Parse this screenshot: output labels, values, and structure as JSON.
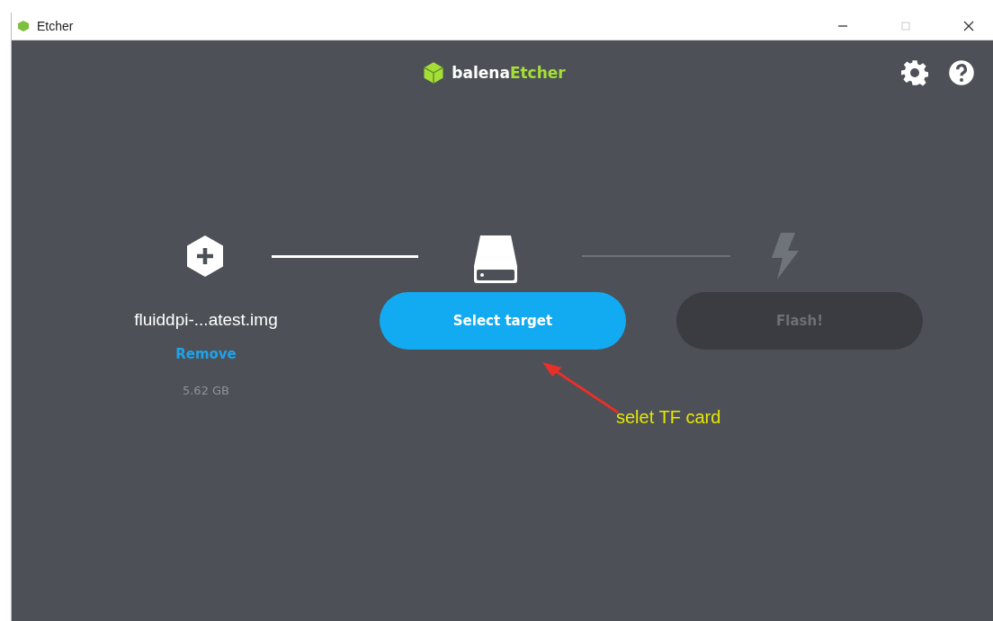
{
  "window": {
    "title": "Etcher"
  },
  "header": {
    "brand_first": "balena",
    "brand_second": "Etcher"
  },
  "steps": [
    {
      "kind": "image"
    },
    {
      "kind": "drive"
    },
    {
      "kind": "flash"
    }
  ],
  "image": {
    "name": "fluiddpi-...atest.img",
    "remove": "Remove",
    "size": "5.62 GB"
  },
  "buttons": [
    {
      "label": "Select target",
      "disabled": false
    },
    {
      "label": "Flash!",
      "disabled": true
    }
  ],
  "annotation": {
    "text": "selet TF card"
  }
}
